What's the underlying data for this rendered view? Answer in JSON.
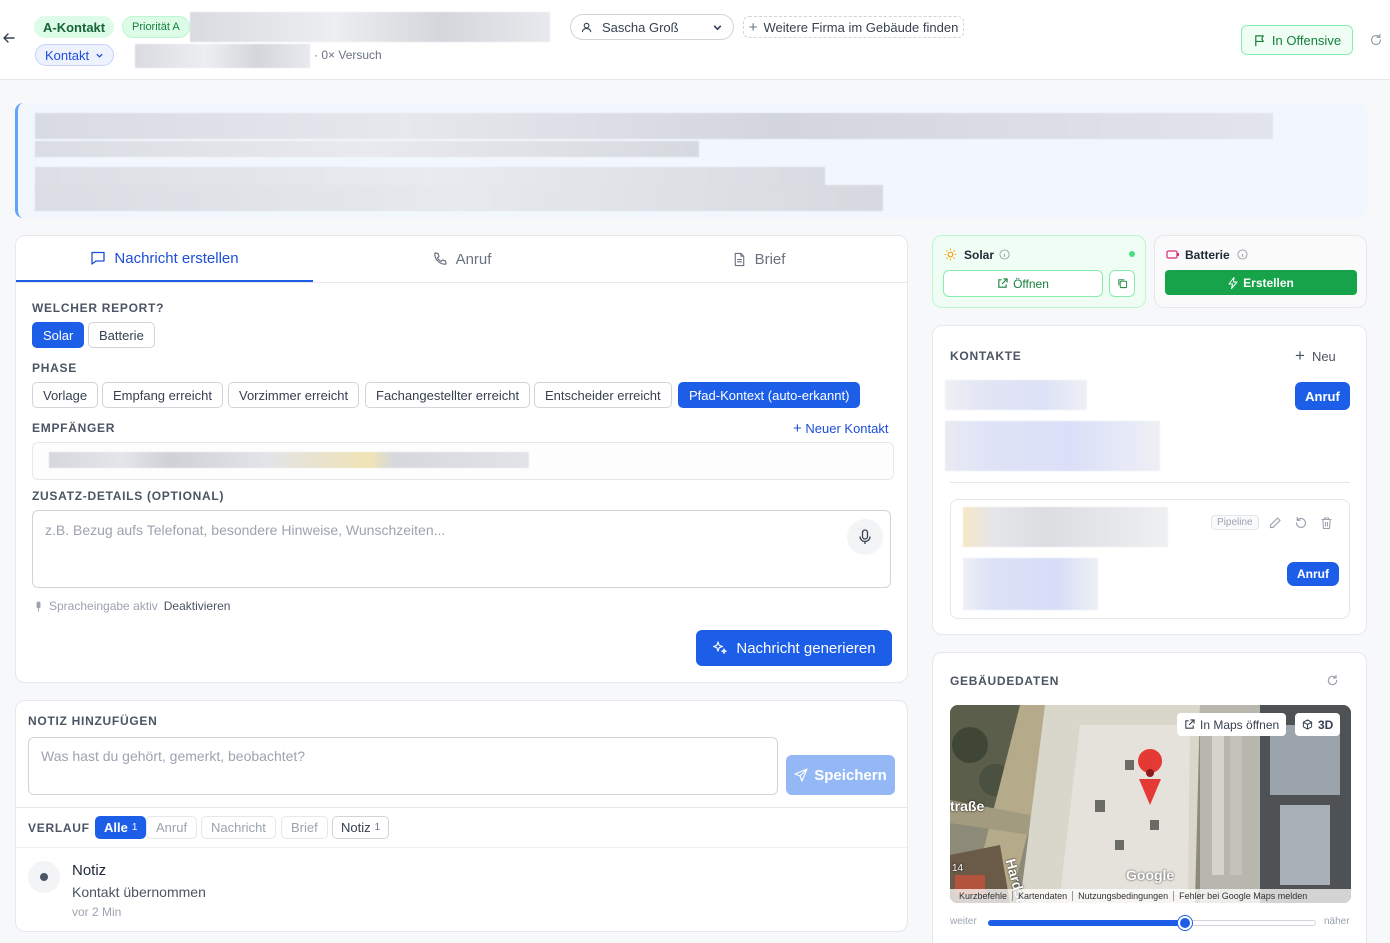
{
  "header": {
    "badge_a_kontakt": "A-Kontakt",
    "badge_prioritaet": "Priorität A",
    "badge_kontakt": "Kontakt",
    "attempts": "0× Versuch",
    "user_select": "Sascha Groß",
    "find_company_button": "Weitere Firma im Gebäude finden",
    "offensive_button": "In Offensive"
  },
  "composer": {
    "tabs": [
      {
        "label": "Nachricht erstellen",
        "icon": "message-icon"
      },
      {
        "label": "Anruf",
        "icon": "phone-icon"
      },
      {
        "label": "Brief",
        "icon": "document-icon"
      }
    ],
    "report_label": "WELCHER REPORT?",
    "report_options": [
      "Solar",
      "Batterie"
    ],
    "phase_label": "PHASE",
    "phase_options": [
      "Vorlage",
      "Empfang erreicht",
      "Vorzimmer erreicht",
      "Fachangestellter erreicht",
      "Entscheider erreicht",
      "Pfad-Kontext (auto-erkannt)"
    ],
    "recipient_label": "EMPFÄNGER",
    "new_contact_link": "Neuer Kontakt",
    "details_label": "ZUSATZ-DETAILS (OPTIONAL)",
    "details_placeholder": "z.B. Bezug aufs Telefonat, besondere Hinweise, Wunschzeiten...",
    "voice_status": "Spracheingabe aktiv",
    "voice_deactivate": "Deaktivieren",
    "generate_button": "Nachricht generieren"
  },
  "note": {
    "label": "NOTIZ HINZUFÜGEN",
    "placeholder": "Was hast du gehört, gemerkt, beobachtet?",
    "save_button": "Speichern"
  },
  "history": {
    "label": "VERLAUF",
    "filters": [
      {
        "label": "Alle",
        "count": "1"
      },
      {
        "label": "Anruf",
        "count": ""
      },
      {
        "label": "Nachricht",
        "count": ""
      },
      {
        "label": "Brief",
        "count": ""
      },
      {
        "label": "Notiz",
        "count": "1"
      }
    ],
    "entries": [
      {
        "type": "Notiz",
        "text": "Kontakt übernommen",
        "time": "vor 2 Min"
      }
    ]
  },
  "reports": {
    "solar": {
      "title": "Solar",
      "open_button": "Öffnen"
    },
    "battery": {
      "title": "Batterie",
      "create_button": "Erstellen"
    }
  },
  "contacts": {
    "label": "KONTAKTE",
    "new_button": "Neu",
    "call_button_1": "Anruf",
    "pipeline_badge": "Pipeline",
    "call_button_2": "Anruf"
  },
  "building": {
    "label": "GEBÄUDEDATEN",
    "open_maps": "In Maps öffnen",
    "view_3d": "3D",
    "map_street_1": "traße",
    "map_street_2": "Hardst",
    "map_house_no": "14",
    "map_logo": "Google",
    "map_footer": [
      "Kurzbefehle",
      "Kartendaten",
      "Nutzungsbedingungen",
      "Fehler bei Google Maps melden"
    ],
    "zoom_min_label": "weiter",
    "zoom_max_label": "näher",
    "zoom_level": 0.6
  },
  "colors": {
    "primary": "#1d5ee8",
    "green": "#16a34a",
    "green_light": "#dcfce7"
  }
}
